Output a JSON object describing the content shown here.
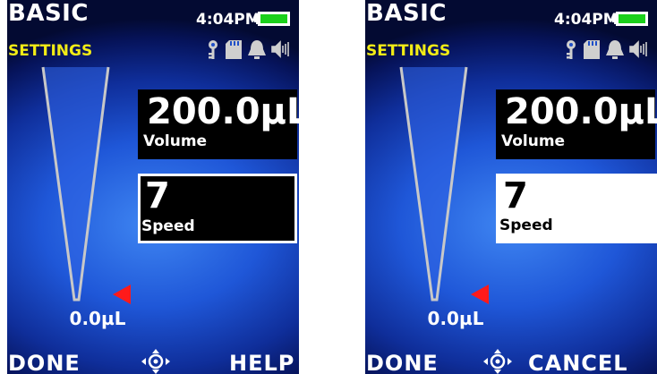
{
  "screens": [
    {
      "header": {
        "title": "BASIC",
        "subtitle": "SETTINGS",
        "time": "4:04PM"
      },
      "status_icons": [
        "key-icon",
        "sd-card-icon",
        "bell-icon",
        "speaker-icon"
      ],
      "battery": {
        "level": 1.0,
        "color": "#1bd01b"
      },
      "tip_readout": "0.0µL",
      "volume": {
        "value": "200.0µL",
        "label": "Volume"
      },
      "speed": {
        "value": "7",
        "label": "Speed",
        "state": "selected"
      },
      "softkeys": {
        "left": "DONE",
        "center_icon": "navigation-pad-icon",
        "right": "HELP"
      }
    },
    {
      "header": {
        "title": "BASIC",
        "subtitle": "SETTINGS",
        "time": "4:04PM"
      },
      "status_icons": [
        "key-icon",
        "sd-card-icon",
        "bell-icon",
        "speaker-icon"
      ],
      "battery": {
        "level": 1.0,
        "color": "#1bd01b"
      },
      "tip_readout": "0.0µL",
      "volume": {
        "value": "200.0µL",
        "label": "Volume"
      },
      "speed": {
        "value": "7",
        "label": "Speed",
        "state": "editing"
      },
      "softkeys": {
        "left": "DONE",
        "center_icon": "navigation-pad-icon",
        "right": "CANCEL"
      }
    }
  ],
  "colors": {
    "subtitle": "#f2ec16",
    "marker": "#ff1a1a",
    "screen_background": "#1f57d8"
  }
}
